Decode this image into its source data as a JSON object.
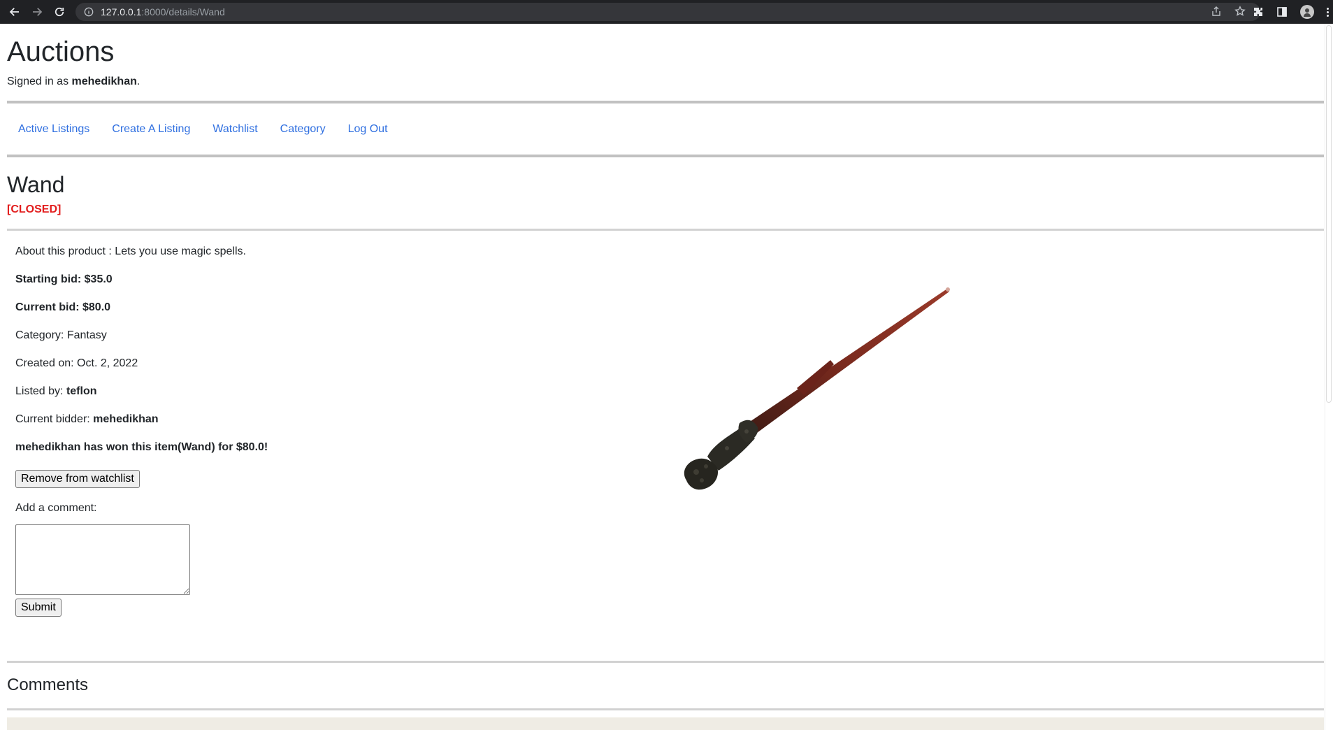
{
  "browser": {
    "url_host": "127.0.0.1",
    "url_path": ":8000/details/Wand"
  },
  "site": {
    "title": "Auctions",
    "signed_in_prefix": "Signed in as ",
    "username": "mehedikhan",
    "signed_in_suffix": "."
  },
  "nav": {
    "items": [
      {
        "label": "Active Listings"
      },
      {
        "label": "Create A Listing"
      },
      {
        "label": "Watchlist"
      },
      {
        "label": "Category"
      },
      {
        "label": "Log Out"
      }
    ]
  },
  "listing": {
    "title": "Wand",
    "status": "[CLOSED]",
    "status_color": "#e21c1c",
    "about": "About this product : Lets you use magic spells.",
    "starting_bid": "Starting bid: $35.0",
    "current_bid": "Current bid: $80.0",
    "category": "Category: Fantasy",
    "created_on": "Created on: Oct. 2, 2022",
    "listed_by_label": "Listed by: ",
    "listed_by": "teflon",
    "current_bidder_label": "Current bidder: ",
    "current_bidder": "mehedikhan",
    "winner_message": "mehedikhan has won this item(Wand) for $80.0!",
    "watchlist_button": "Remove from watchlist",
    "comment_label": "Add a comment:",
    "submit_button": "Submit",
    "image": "wand-image"
  },
  "comments": {
    "heading": "Comments"
  },
  "colors": {
    "link": "#2f6fe0",
    "browser_bar": "#202124"
  }
}
